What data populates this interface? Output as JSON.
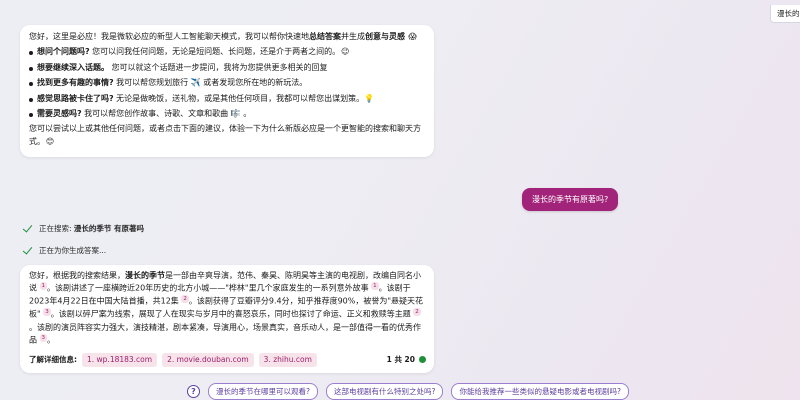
{
  "tab": {
    "label": "漫长的季"
  },
  "intro": {
    "p1_a": "您好，这里是必应！我是微软必应的新型人工智能聊天模式，我可以帮你快速地",
    "p1_b1": "总结答案",
    "p1_c": "并生成",
    "p1_b2": "创意与灵感",
    "p1_emoji": "😱",
    "items": [
      {
        "bold": "想问个问题吗?",
        "text": " 您可以问我任何问题，无论是短问题、长问题，还是介于两者之间的。",
        "emoji": "😉"
      },
      {
        "bold": "想要继续深入话题。",
        "text": " 您可以就这个话题进一步提问，我将为您提供更多相关的回复",
        "emoji": ""
      },
      {
        "bold": "找到更多有趣的事情?",
        "text": " 我可以帮您规划旅行 ✈️ 或者发现您所在地的新玩法。",
        "emoji": ""
      },
      {
        "bold": "感觉思路被卡住了吗?",
        "text": " 无论是做晚饭，送礼物，或是其他任何项目，我都可以帮您出谋划策。",
        "emoji": "💡"
      },
      {
        "bold": "需要灵感吗?",
        "text": " 我可以帮您创作故事、诗歌、文章和歌曲 ",
        "emoji": "🎼 。"
      }
    ],
    "p2": "您可以尝试以上或其他任何问题，或者点击下面的建议，体验一下为什么新版必应是一个更智能的搜索和聊天方式。",
    "p2_emoji": "😊"
  },
  "user": {
    "message": "漫长的季节有原著吗?"
  },
  "status": {
    "searching_prefix": "正在搜索: ",
    "searching_query": "漫长的季节 有原著吗",
    "generating": "正在为你生成答案..."
  },
  "answer": {
    "a1": "您好，根据我的搜索结果，",
    "a1_bold": "漫长的季节",
    "a2": "是一部由辛爽导演，范伟、秦昊、陈明昊等主演的电视剧，改编自同名小说",
    "c1": "1",
    "a3": "。该剧讲述了一座横跨近20年历史的北方小城——\"桦林\"里几个家庭发生的一系列意外故事",
    "c2": "1",
    "a4": "。该剧于2023年4月22日在中国大陆首播，共12集",
    "c3": "2",
    "a5": "。该剧获得了豆瓣评分9.4分，知乎推荐度90%，被誉为\"悬疑天花板\"",
    "c4": "3",
    "a6": "。该剧以碎尸案为线索，展现了人在现实与岁月中的喜怒哀乐，同时也探讨了命运、正义和救赎等主题",
    "c5": "2",
    "a7": "。该剧的演员阵容实力强大，演技精湛，剧本紧凑，导演用心，场景真实，音乐动人，是一部值得一看的优秀作品",
    "c6": "3",
    "a8": "。"
  },
  "learn_more": {
    "label": "了解详细信息:",
    "sources": [
      "1. wp.18183.com",
      "2. movie.douban.com",
      "3. zhihu.com"
    ],
    "count": "1 共 20"
  },
  "suggestions": {
    "help": "?",
    "items": [
      "漫长的季节在哪里可以观看?",
      "这部电视剧有什么特别之处吗?",
      "你能给我推荐一些类似的悬疑电影或者电视剧吗?"
    ]
  },
  "colors": {
    "user_bubble": "#a2247a",
    "accent": "#5b3fa0",
    "check": "#1f8f3a"
  }
}
